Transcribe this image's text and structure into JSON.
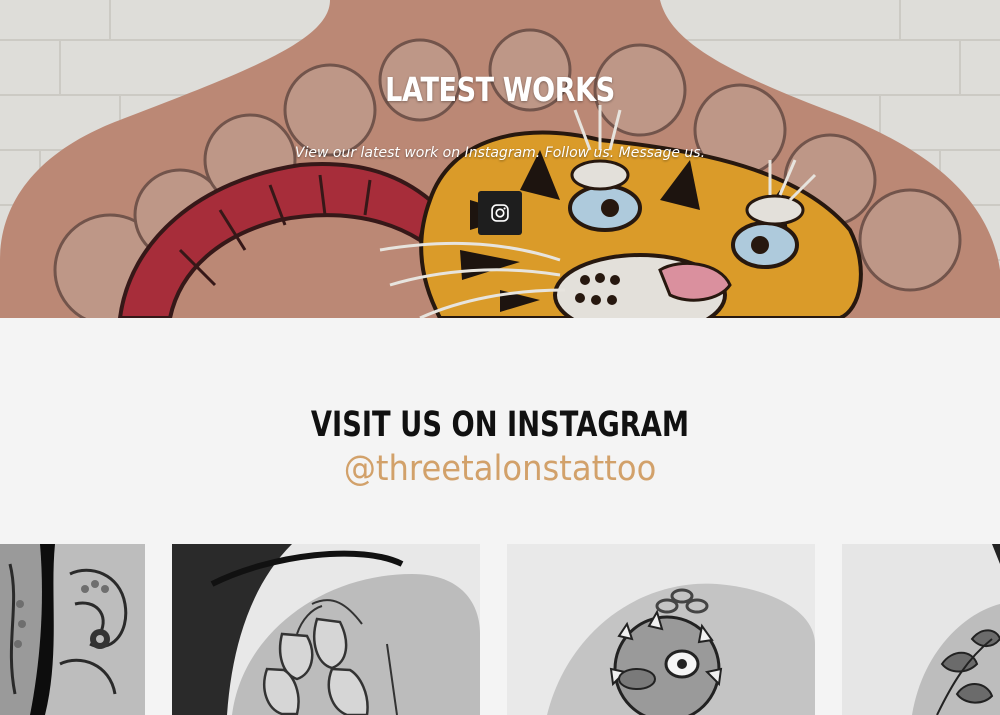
{
  "hero": {
    "title": "LATEST WORKS",
    "subtitle": "View our latest work on Instagram. Follow us. Message us.",
    "instagram_button_icon": "instagram-icon"
  },
  "instagram": {
    "title": "VISIT US ON INSTAGRAM",
    "handle": "@threetalonstattoo",
    "photos": [
      "octopus-tattoo",
      "bluebell-flower-tattoo",
      "pufferfish-tattoo",
      "botanical-tattoo"
    ]
  },
  "colors": {
    "page_bg": "#f4f4f4",
    "handle": "#d2a16a",
    "button_bg": "#1e1e1e",
    "title_text": "#111111"
  }
}
